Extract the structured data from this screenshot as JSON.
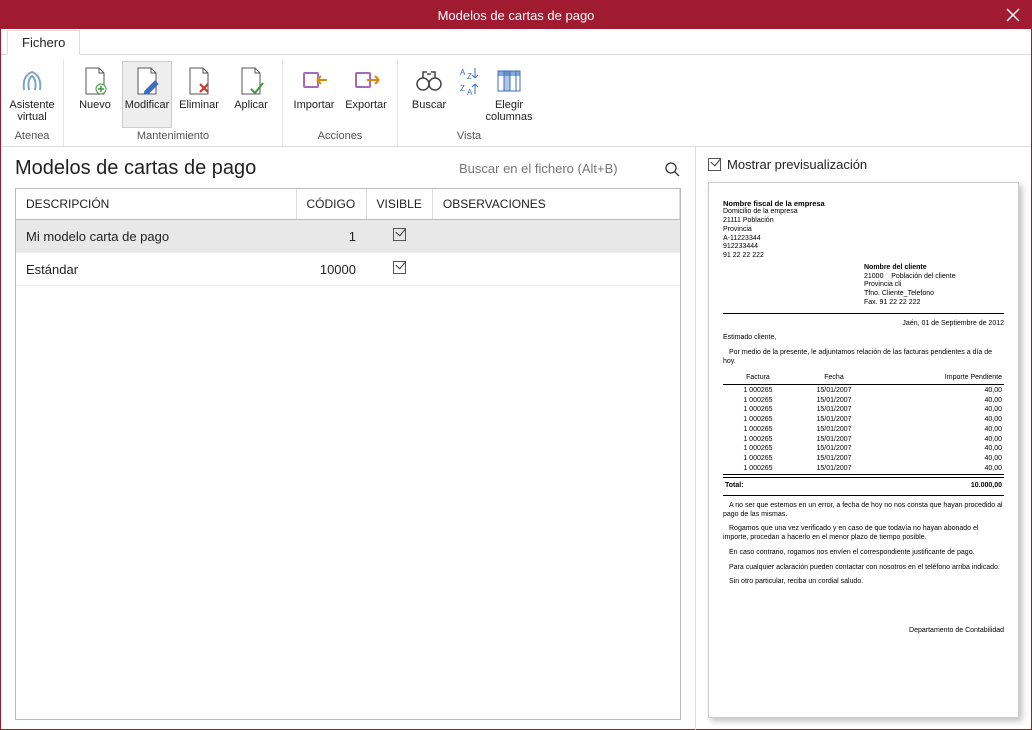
{
  "window": {
    "title": "Modelos de cartas de pago"
  },
  "tabs": {
    "file": "Fichero"
  },
  "ribbon": {
    "groups": [
      {
        "label": "Atenea",
        "buttons": [
          {
            "key": "asistente",
            "label": "Asistente\nvirtual"
          }
        ]
      },
      {
        "label": "Mantenimiento",
        "buttons": [
          {
            "key": "nuevo",
            "label": "Nuevo"
          },
          {
            "key": "modificar",
            "label": "Modificar"
          },
          {
            "key": "eliminar",
            "label": "Eliminar"
          },
          {
            "key": "aplicar",
            "label": "Aplicar"
          }
        ]
      },
      {
        "label": "Acciones",
        "buttons": [
          {
            "key": "importar",
            "label": "Importar"
          },
          {
            "key": "exportar",
            "label": "Exportar"
          }
        ]
      },
      {
        "label": "Vista",
        "buttons": [
          {
            "key": "buscar",
            "label": "Buscar"
          },
          {
            "key": "ordenar",
            "label": ""
          },
          {
            "key": "columnas",
            "label": "Elegir\ncolumnas"
          }
        ]
      }
    ]
  },
  "page": {
    "title": "Modelos de cartas de pago",
    "search_placeholder": "Buscar en el fichero (Alt+B)"
  },
  "grid": {
    "columns": {
      "descripcion": "DESCRIPCIÓN",
      "codigo": "CÓDIGO",
      "visible": "VISIBLE",
      "observaciones": "OBSERVACIONES"
    },
    "rows": [
      {
        "descripcion": "Mi modelo carta de pago",
        "codigo": "1",
        "visible": true,
        "observaciones": "",
        "selected": true
      },
      {
        "descripcion": "Estándar",
        "codigo": "10000",
        "visible": true,
        "observaciones": "",
        "selected": false
      }
    ]
  },
  "preview": {
    "checkbox_label": "Mostrar previsualización",
    "company": {
      "name": "Nombre fiscal de la empresa",
      "lines": [
        "Domicilio de la empresa",
        "21111  Población",
        "Provincia",
        "A-11223344",
        "912233444",
        "91 22 22 222"
      ]
    },
    "client": {
      "name": "Nombre del cliente",
      "line1_a": "21000",
      "line1_b": "Población del cliente",
      "line2": "Provincia cli",
      "line3": "Tfno.  Cliente_Telefono",
      "line4": "Fax.    91 22 22 222"
    },
    "date": "Jaén, 01  de  Septiembre  de  2012",
    "greeting": "Estimado cliente,",
    "intro": "Por medio de la presente, le adjuntamos relación de las facturas pendientes a día de hoy.",
    "table": {
      "headers": {
        "factura": "Factura",
        "fecha": "Fecha",
        "importe": "Importe Pendiente"
      },
      "rows": [
        {
          "f": "1 000265",
          "d": "15/01/2007",
          "i": "40,00"
        },
        {
          "f": "1 000265",
          "d": "15/01/2007",
          "i": "40,00"
        },
        {
          "f": "1 000265",
          "d": "15/01/2007",
          "i": "40,00"
        },
        {
          "f": "1 000265",
          "d": "15/01/2007",
          "i": "40,00"
        },
        {
          "f": "1 000265",
          "d": "15/01/2007",
          "i": "40,00"
        },
        {
          "f": "1 000265",
          "d": "15/01/2007",
          "i": "40,00"
        },
        {
          "f": "1 000265",
          "d": "15/01/2007",
          "i": "40,00"
        },
        {
          "f": "1 000265",
          "d": "15/01/2007",
          "i": "40,00"
        },
        {
          "f": "1 000265",
          "d": "15/01/2007",
          "i": "40,00"
        }
      ],
      "total_label": "Total:",
      "total_value": "10.000,00"
    },
    "paras": [
      "A no ser que estemos en un error, a fecha de hoy no nos consta que hayan procedido al pago de las mismas.",
      "Rogamos que una vez verificado y en caso de que todavía no hayan abonado el importe, procedan a hacerlo en el menor plazo de tiempo posible.",
      "En caso contrario, rogamos nos envíen el correspondiente justificante de pago.",
      "Para cualquier aclaración pueden contactar con nosotros en el teléfono arriba indicado.",
      "Sin otro particular, reciba un cordial saludo."
    ],
    "signature": "Departamento de Contabilidad"
  }
}
